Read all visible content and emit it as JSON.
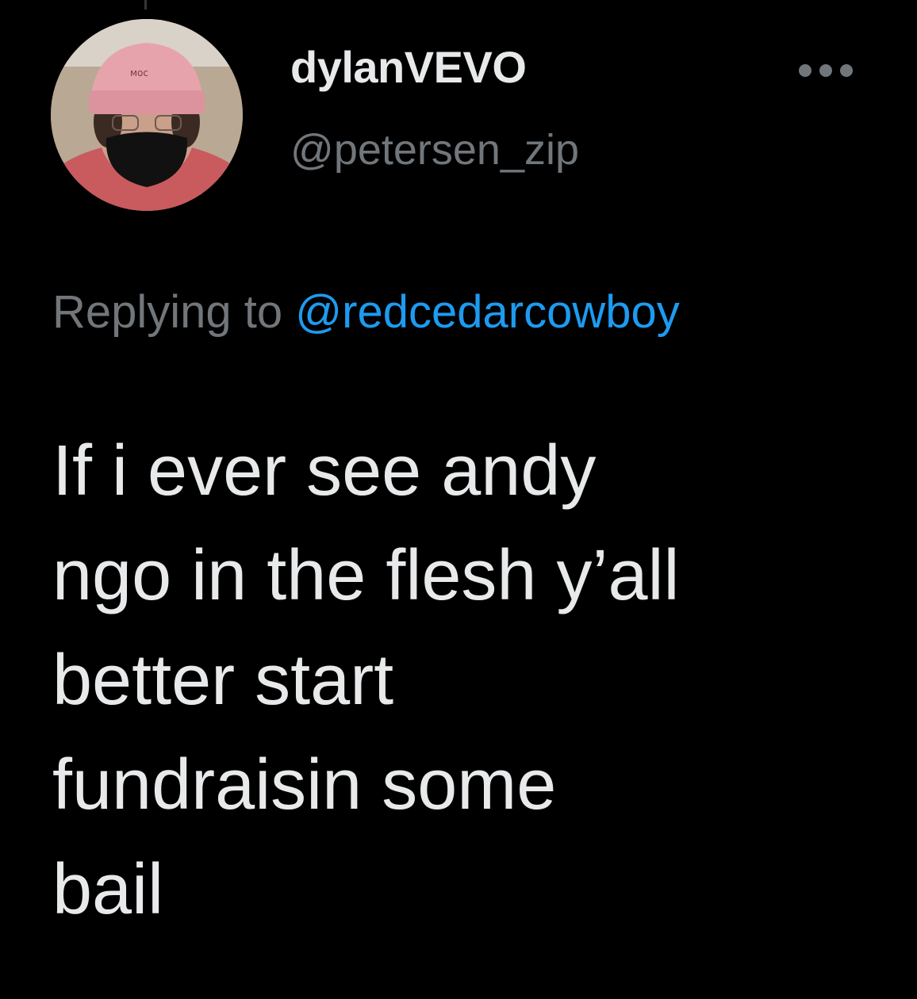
{
  "tweet": {
    "author": {
      "display_name": "dylanVEVO",
      "handle": "@petersen_zip",
      "avatar_icon": "profile-photo-avatar"
    },
    "more_icon": "more-horizontal-icon",
    "reply_context": {
      "prefix": "Replying to",
      "mention": "@redcedarcowboy"
    },
    "text": "If i ever see andy\nngo in the flesh y’all\nbetter start\nfundraisin some\nbail"
  },
  "colors": {
    "background": "#000000",
    "text_primary": "#e7e9ea",
    "text_secondary": "#71767b",
    "link": "#1d9bf0"
  }
}
